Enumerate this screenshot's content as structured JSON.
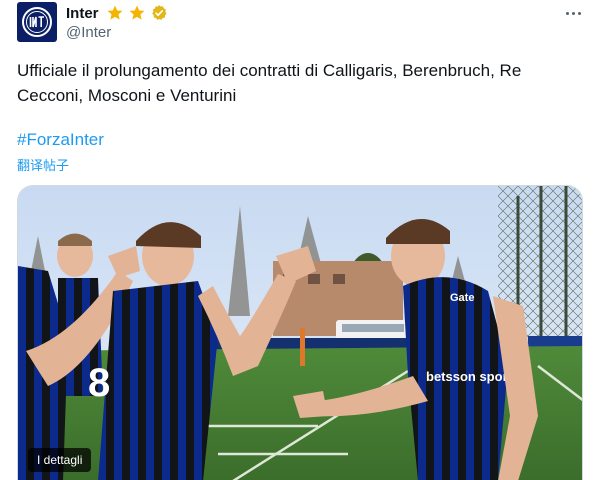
{
  "tweet": {
    "display_name": "Inter",
    "handle": "@Inter",
    "text": "Ufficiale il prolungamento dei contratti di Calligaris, Berenbruch, Re Cecconi, Mosconi e Venturini",
    "hashtag": "#ForzaInter",
    "translate_label": "翻译帖子",
    "badges": [
      "star-icon",
      "star-icon",
      "verified-icon"
    ],
    "media": {
      "details_label": "I dettagli",
      "jersey_sponsor": "betsson sport",
      "jersey_sponsor_2": "Gate",
      "jersey_number": "8"
    }
  },
  "colors": {
    "link": "#1d9bf0",
    "text": "#0f1419",
    "muted": "#536471",
    "inter_blue": "#0a1f66",
    "star": "#f4b400",
    "verified": "#e2b719"
  }
}
